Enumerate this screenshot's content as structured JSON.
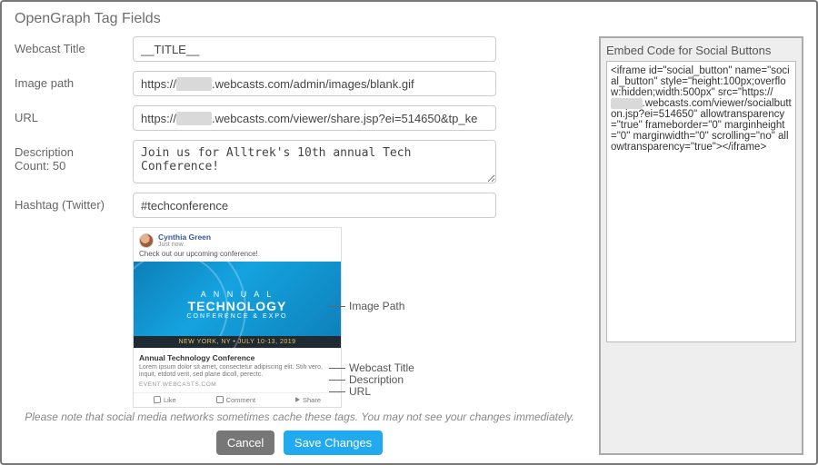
{
  "section_title": "OpenGraph Tag Fields",
  "form": {
    "webcast_title": {
      "label": "Webcast Title",
      "value": "__TITLE__"
    },
    "image_path": {
      "label": "Image path",
      "value_prefix": "https://",
      "value_host_hidden": "xxxxxx",
      "value_suffix": ".webcasts.com/admin/images/blank.gif"
    },
    "url": {
      "label": "URL",
      "value_prefix": "https://",
      "value_host_hidden": "xxxxxx",
      "value_suffix": ".webcasts.com/viewer/share.jsp?ei=514650&tp_ke"
    },
    "description": {
      "label_line1": "Description",
      "label_line2": "Count: 50",
      "value": "Join us for Alltrek's 10th annual Tech Conference!"
    },
    "hashtag": {
      "label": "Hashtag (Twitter)",
      "value": "#techconference"
    }
  },
  "preview": {
    "author": "Cynthia Green",
    "timestamp": "Just now",
    "post_text": "Check out our upcoming conference!",
    "image_line1": "A N N U A L",
    "image_line2": "TECHNOLOGY",
    "image_line3": "CONFERENCE & EXPO",
    "image_strip": "NEW YORK, NY • JULY 10-13, 2019",
    "meta_title": "Annual Technology Conference",
    "meta_desc": "Lorem ipsum dolor sit amet, consectetur adipiscing elit. Stih vero, inquit, etdotd verit, sed plane dicoll, perectc.",
    "meta_url": "EVENT.WEBCASTS.COM",
    "action_like": "Like",
    "action_comment": "Comment",
    "action_share": "Share"
  },
  "callouts": {
    "image_path": "Image Path",
    "webcast_title": "Webcast Title",
    "description": "Description",
    "url": "URL"
  },
  "note": "Please note that social media networks sometimes cache these tags. You may not see your changes immediately.",
  "buttons": {
    "cancel": "Cancel",
    "save": "Save Changes"
  },
  "embed": {
    "title": "Embed Code for Social Buttons",
    "code_prefix": "<iframe id=\"social_button\" name=\"social_button\" style=\"height:100px;overflow:hidden;width:500px\" src=\"https://",
    "code_host_hidden": "xxxxxx",
    "code_suffix": ".webcasts.com/viewer/socialbutton.jsp?ei=514650\" allowtransparency=\"true\" frameborder=\"0\" marginheight=\"0\" marginwidth=\"0\" scrolling=\"no\" allowtransparency=\"true\"></iframe>"
  }
}
